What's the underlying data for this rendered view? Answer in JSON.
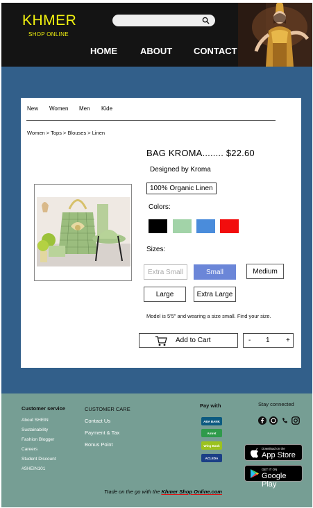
{
  "header": {
    "logo": "KHMER",
    "logo_sub": "SHOP ONLINE",
    "nav": [
      "HOME",
      "ABOUT",
      "CONTACT"
    ]
  },
  "tabs": [
    "New",
    "Women",
    "Men",
    "Kide"
  ],
  "breadcrumb": "Women > Tops > Blouses > Linen",
  "product": {
    "title": "BAG KROMA........ $22.60",
    "designer": "Designed by Kroma",
    "material": "100% Organic Linen",
    "colors_label": "Colors:",
    "colors": [
      "#000000",
      "#a2d3a8",
      "#4a8cdb",
      "#f20d0d"
    ],
    "sizes_label": "Sizes:",
    "sizes": [
      "Extra Small",
      "Small",
      "Medium",
      "Large",
      "Extra Large"
    ],
    "selected_size": "Small",
    "note": "Model is 5'5\" and wearing a size small. Find your size.",
    "add_to_cart": "Add to Cart",
    "quantity": "1",
    "minus": "-",
    "plus": "+"
  },
  "footer": {
    "customer_service_title": "Customer service",
    "customer_service_items": [
      "About SHEIN",
      "Sustainability",
      "Fashion Blogger",
      "Careers",
      "Student Discount",
      "#SHEIN101"
    ],
    "customer_care_title": "CUSTOMER CARE",
    "customer_care_items": [
      "Contact Us",
      "Payment & Tax",
      "Bonus Point"
    ],
    "pay_title": "Pay with",
    "pay_methods": [
      "ABA BANK",
      "Amret",
      "Wing Bank",
      "ACLEDA"
    ],
    "stay_title": "Stay connected",
    "app_store_small": "Download on the",
    "app_store_big": "App Store",
    "google_small": "GET IT ON",
    "google_big": "Google Play",
    "tagline_prefix": "Trade on the go with the",
    "tagline_brand": "Khmer Shop Online.com"
  },
  "colors": {
    "header_bg": "#141414",
    "logo": "#f2f20f",
    "band": "#325f8a",
    "footer": "#769e94",
    "selected_size": "#6b86d8"
  }
}
